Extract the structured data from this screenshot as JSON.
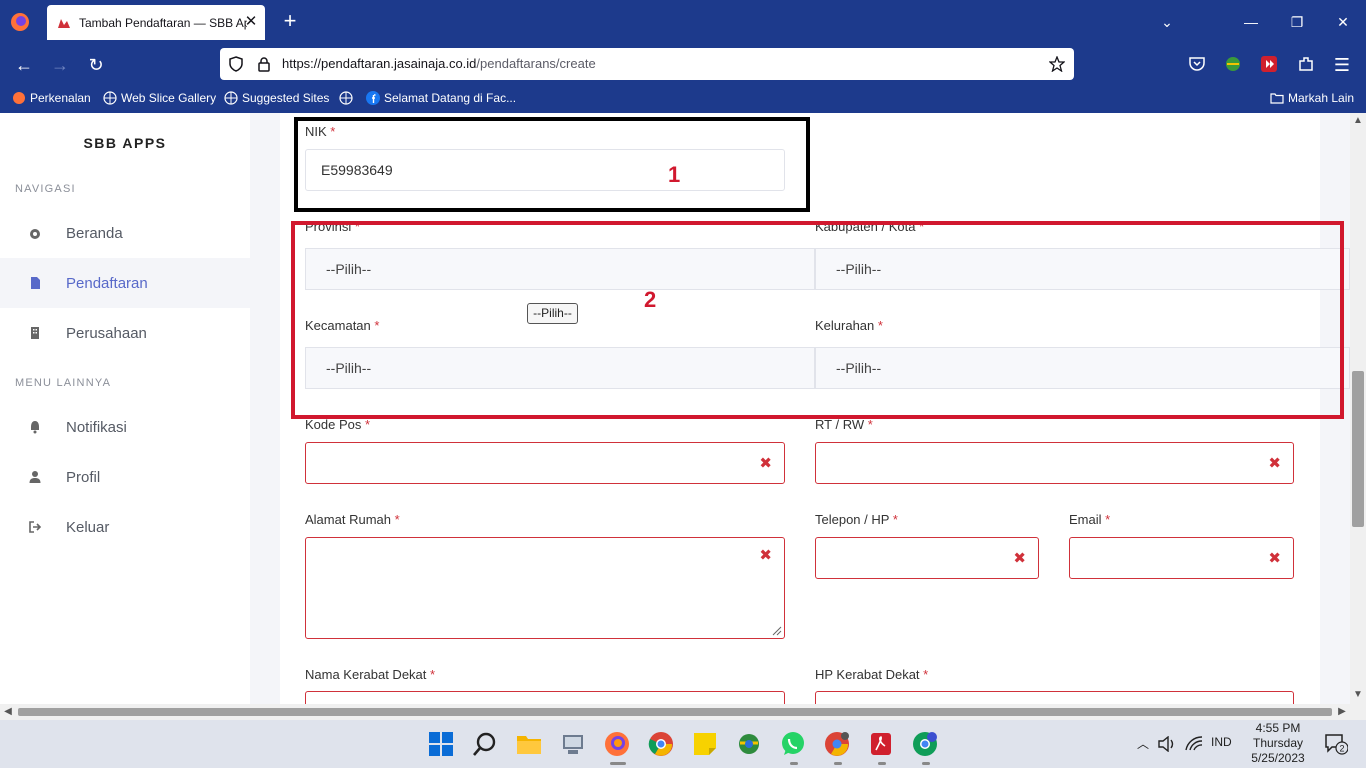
{
  "browser": {
    "tab_title": "Tambah Pendaftaran — SBB Apps",
    "url_host": "https://pendaftaran.jasainaja.co.id",
    "url_path": "/pendaftarans/create",
    "bookmarks": [
      "Perkenalan",
      "Web Slice Gallery",
      "Suggested Sites",
      "Selamat Datang di Fac..."
    ],
    "other_bookmarks": "Markah Lain"
  },
  "sidebar": {
    "brand": "SBB APPS",
    "section_nav": "NAVIGASI",
    "section_more": "MENU LAINNYA",
    "items": [
      {
        "label": "Beranda",
        "icon": "dashboard-icon"
      },
      {
        "label": "Pendaftaran",
        "icon": "document-icon",
        "active": true
      },
      {
        "label": "Perusahaan",
        "icon": "building-icon"
      },
      {
        "label": "Notifikasi",
        "icon": "bell-icon"
      },
      {
        "label": "Profil",
        "icon": "user-icon"
      },
      {
        "label": "Keluar",
        "icon": "logout-icon"
      }
    ]
  },
  "form": {
    "nik": {
      "label": "NIK",
      "value": "E59983649"
    },
    "provinsi": {
      "label": "Provinsi",
      "value": "--Pilih--"
    },
    "kabupaten": {
      "label": "Kabupaten / Kota",
      "value": "--Pilih--"
    },
    "kecamatan": {
      "label": "Kecamatan",
      "value": "--Pilih--"
    },
    "kelurahan": {
      "label": "Kelurahan",
      "value": "--Pilih--"
    },
    "kode_pos": {
      "label": "Kode Pos"
    },
    "rt_rw": {
      "label": "RT / RW"
    },
    "alamat": {
      "label": "Alamat Rumah"
    },
    "telepon": {
      "label": "Telepon / HP"
    },
    "email": {
      "label": "Email"
    },
    "kerabat_nama": {
      "label": "Nama Kerabat Dekat"
    },
    "kerabat_hp": {
      "label": "HP Kerabat Dekat"
    },
    "required_mark": "*",
    "error_mark": "✖"
  },
  "annotations": {
    "box1": "1",
    "box2": "2",
    "tooltip": "--Pilih--"
  },
  "taskbar": {
    "language": "IND",
    "time": "4:55 PM",
    "day": "Thursday",
    "date": "5/25/2023",
    "notif_count": "2"
  }
}
